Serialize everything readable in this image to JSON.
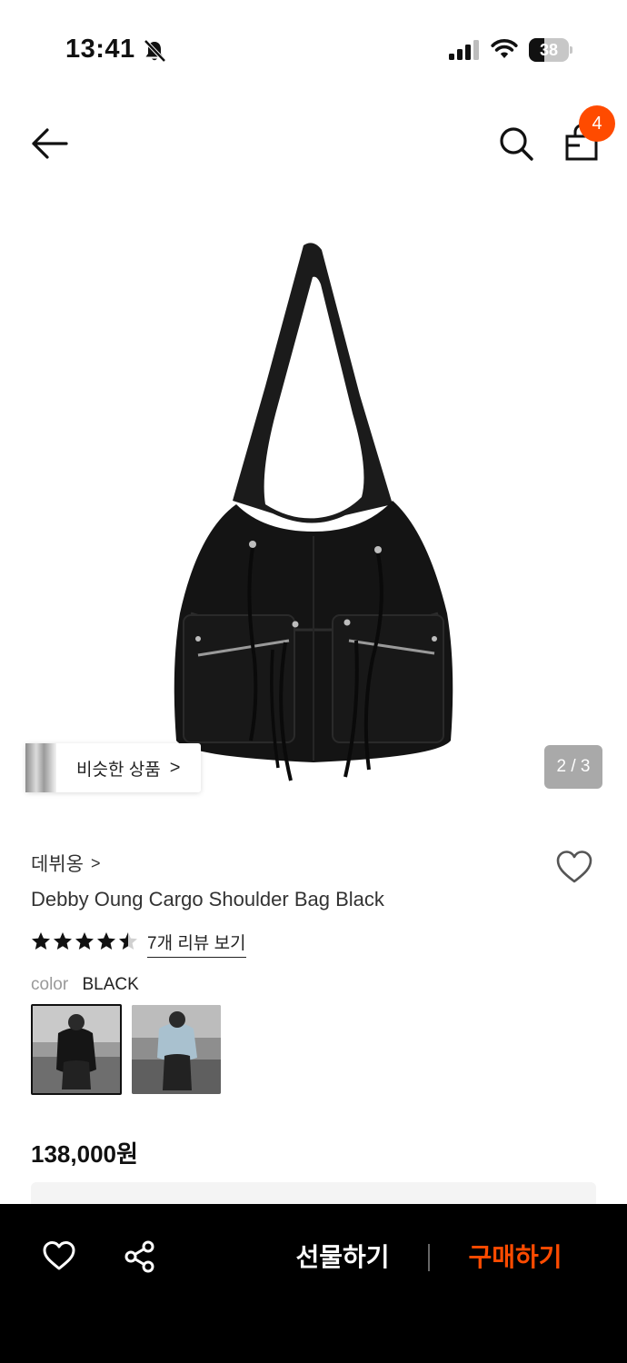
{
  "status_bar": {
    "time": "13:41",
    "battery_level": "38",
    "battery_fraction": 0.38,
    "icons": [
      "bell-slash-icon",
      "cellular-signal-icon",
      "wifi-icon",
      "battery-icon"
    ]
  },
  "nav": {
    "back_icon": "arrow-left-icon",
    "search_icon": "search-icon",
    "cart_icon": "shopping-bag-icon",
    "cart_count": "4"
  },
  "gallery": {
    "similar_label": "비슷한 상품",
    "similar_chevron": ">",
    "page_indicator": "2 / 3",
    "current_page": 2,
    "total_pages": 3
  },
  "product": {
    "brand": "데뷔옹",
    "brand_chevron": ">",
    "title": "Debby Oung Cargo Shoulder Bag Black",
    "rating": 4.5,
    "review_link": "7개 리뷰 보기",
    "color_label": "color",
    "color_value": "BLACK",
    "price": "138,000원"
  },
  "bottom_bar": {
    "gift_label": "선물하기",
    "buy_label": "구매하기",
    "like_icon": "heart-outline-icon",
    "share_icon": "share-icon"
  },
  "colors": {
    "accent": "#ff4b00",
    "bottom_bar_bg": "#000000",
    "indicator_bg": "#a9a9a9"
  }
}
